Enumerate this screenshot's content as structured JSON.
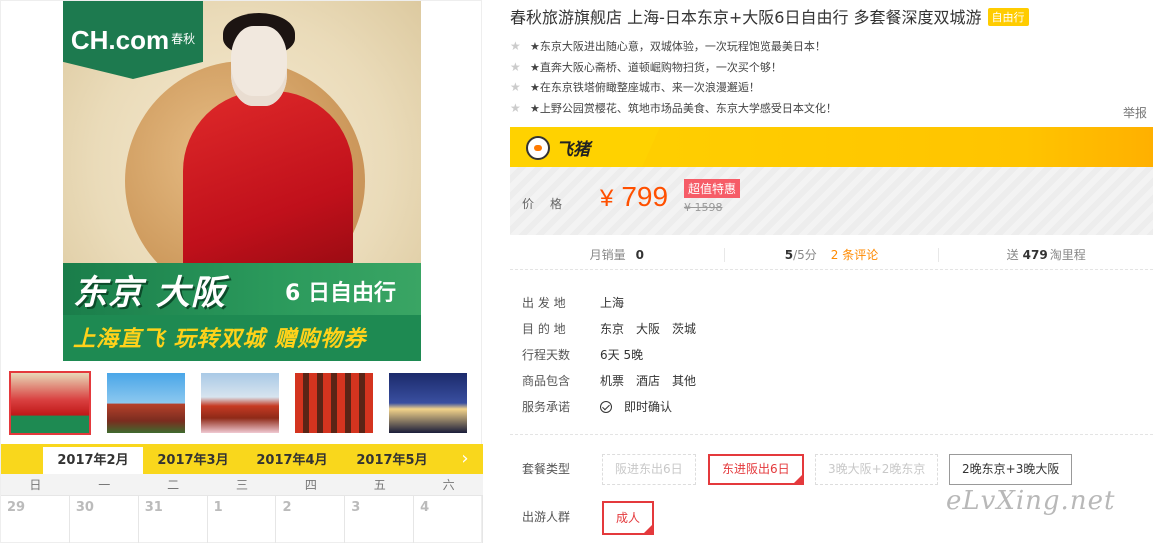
{
  "gallery": {
    "logo": {
      "brand": "CH.com",
      "sub": "春秋"
    },
    "banner": {
      "main": "东京 大阪",
      "days": "6 日自由行",
      "sub": "上海直飞 玩转双城 赠购物券"
    },
    "thumb_count": 5
  },
  "calendar": {
    "tabs": [
      "2017年2月",
      "2017年3月",
      "2017年4月",
      "2017年5月"
    ],
    "active_tab": 0,
    "next_icon": "chevron-right-icon",
    "weekdays": [
      "日",
      "一",
      "二",
      "三",
      "四",
      "五",
      "六"
    ],
    "days": [
      "29",
      "30",
      "31",
      "1",
      "2",
      "3",
      "4"
    ]
  },
  "product": {
    "title": "春秋旅游旗舰店 上海-日本东京+大阪6日自由行 多套餐深度双城游",
    "title_tag": "自由行",
    "features": [
      "★东京大阪进出随心意，双城体验，一次玩程饱览最美日本！",
      "★直奔大阪心斋桥、道顿崛购物扫货，一次买个够！",
      "★在东京铁塔俯瞰整座城市、来一次浪漫邂逅！",
      "★上野公园赏樱花、筑地市场品美食、东京大学感受日本文化！"
    ],
    "report": "举报",
    "brand_name": "飞猪",
    "price_label": "价格",
    "price_symbol": "¥",
    "price": "799",
    "deal_tag": "超值特惠",
    "orig_price": "¥ 1598",
    "stats": {
      "monthly_sales_label": "月销量",
      "monthly_sales": "0",
      "rating": "5",
      "rating_suffix": "/5分",
      "reviews": "2 条评论",
      "miles_prefix": "送",
      "miles": "479",
      "miles_suffix": "淘里程"
    },
    "details": {
      "departure_label": "出 发 地",
      "departure": "上海",
      "destination_label": "目 的 地",
      "destinations": [
        "东京",
        "大阪",
        "茨城"
      ],
      "days_label": "行程天数",
      "days": "6天 5晚",
      "includes_label": "商品包含",
      "includes": [
        "机票",
        "酒店",
        "其他"
      ],
      "promise_label": "服务承诺",
      "promise": "即时确认"
    },
    "package_label": "套餐类型",
    "packages": [
      "阪进东出6日",
      "东进阪出6日",
      "3晚大阪+2晚东京",
      "2晚东京+3晚大阪"
    ],
    "selected_package": 1,
    "group_label": "出游人群",
    "group": "成人"
  },
  "watermark": "eLvXing.net"
}
